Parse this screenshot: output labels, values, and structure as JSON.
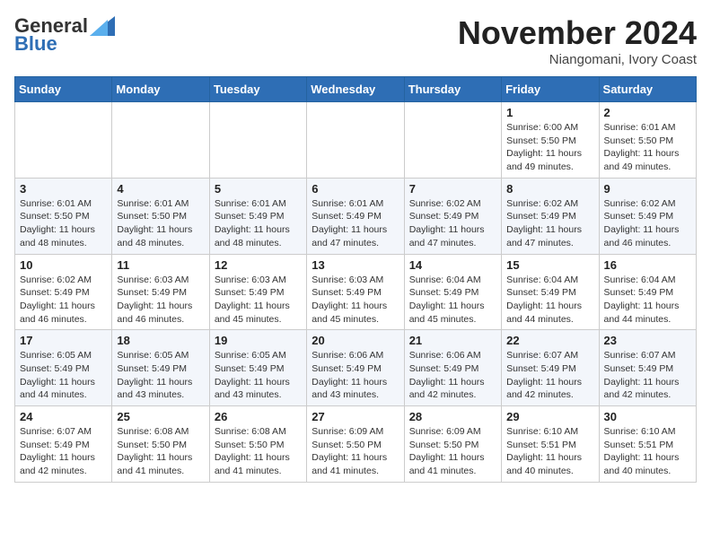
{
  "logo": {
    "general": "General",
    "blue": "Blue"
  },
  "header": {
    "month": "November 2024",
    "location": "Niangomani, Ivory Coast"
  },
  "weekdays": [
    "Sunday",
    "Monday",
    "Tuesday",
    "Wednesday",
    "Thursday",
    "Friday",
    "Saturday"
  ],
  "weeks": [
    [
      {
        "day": "",
        "info": ""
      },
      {
        "day": "",
        "info": ""
      },
      {
        "day": "",
        "info": ""
      },
      {
        "day": "",
        "info": ""
      },
      {
        "day": "",
        "info": ""
      },
      {
        "day": "1",
        "info": "Sunrise: 6:00 AM\nSunset: 5:50 PM\nDaylight: 11 hours and 49 minutes."
      },
      {
        "day": "2",
        "info": "Sunrise: 6:01 AM\nSunset: 5:50 PM\nDaylight: 11 hours and 49 minutes."
      }
    ],
    [
      {
        "day": "3",
        "info": "Sunrise: 6:01 AM\nSunset: 5:50 PM\nDaylight: 11 hours and 48 minutes."
      },
      {
        "day": "4",
        "info": "Sunrise: 6:01 AM\nSunset: 5:50 PM\nDaylight: 11 hours and 48 minutes."
      },
      {
        "day": "5",
        "info": "Sunrise: 6:01 AM\nSunset: 5:49 PM\nDaylight: 11 hours and 48 minutes."
      },
      {
        "day": "6",
        "info": "Sunrise: 6:01 AM\nSunset: 5:49 PM\nDaylight: 11 hours and 47 minutes."
      },
      {
        "day": "7",
        "info": "Sunrise: 6:02 AM\nSunset: 5:49 PM\nDaylight: 11 hours and 47 minutes."
      },
      {
        "day": "8",
        "info": "Sunrise: 6:02 AM\nSunset: 5:49 PM\nDaylight: 11 hours and 47 minutes."
      },
      {
        "day": "9",
        "info": "Sunrise: 6:02 AM\nSunset: 5:49 PM\nDaylight: 11 hours and 46 minutes."
      }
    ],
    [
      {
        "day": "10",
        "info": "Sunrise: 6:02 AM\nSunset: 5:49 PM\nDaylight: 11 hours and 46 minutes."
      },
      {
        "day": "11",
        "info": "Sunrise: 6:03 AM\nSunset: 5:49 PM\nDaylight: 11 hours and 46 minutes."
      },
      {
        "day": "12",
        "info": "Sunrise: 6:03 AM\nSunset: 5:49 PM\nDaylight: 11 hours and 45 minutes."
      },
      {
        "day": "13",
        "info": "Sunrise: 6:03 AM\nSunset: 5:49 PM\nDaylight: 11 hours and 45 minutes."
      },
      {
        "day": "14",
        "info": "Sunrise: 6:04 AM\nSunset: 5:49 PM\nDaylight: 11 hours and 45 minutes."
      },
      {
        "day": "15",
        "info": "Sunrise: 6:04 AM\nSunset: 5:49 PM\nDaylight: 11 hours and 44 minutes."
      },
      {
        "day": "16",
        "info": "Sunrise: 6:04 AM\nSunset: 5:49 PM\nDaylight: 11 hours and 44 minutes."
      }
    ],
    [
      {
        "day": "17",
        "info": "Sunrise: 6:05 AM\nSunset: 5:49 PM\nDaylight: 11 hours and 44 minutes."
      },
      {
        "day": "18",
        "info": "Sunrise: 6:05 AM\nSunset: 5:49 PM\nDaylight: 11 hours and 43 minutes."
      },
      {
        "day": "19",
        "info": "Sunrise: 6:05 AM\nSunset: 5:49 PM\nDaylight: 11 hours and 43 minutes."
      },
      {
        "day": "20",
        "info": "Sunrise: 6:06 AM\nSunset: 5:49 PM\nDaylight: 11 hours and 43 minutes."
      },
      {
        "day": "21",
        "info": "Sunrise: 6:06 AM\nSunset: 5:49 PM\nDaylight: 11 hours and 42 minutes."
      },
      {
        "day": "22",
        "info": "Sunrise: 6:07 AM\nSunset: 5:49 PM\nDaylight: 11 hours and 42 minutes."
      },
      {
        "day": "23",
        "info": "Sunrise: 6:07 AM\nSunset: 5:49 PM\nDaylight: 11 hours and 42 minutes."
      }
    ],
    [
      {
        "day": "24",
        "info": "Sunrise: 6:07 AM\nSunset: 5:49 PM\nDaylight: 11 hours and 42 minutes."
      },
      {
        "day": "25",
        "info": "Sunrise: 6:08 AM\nSunset: 5:50 PM\nDaylight: 11 hours and 41 minutes."
      },
      {
        "day": "26",
        "info": "Sunrise: 6:08 AM\nSunset: 5:50 PM\nDaylight: 11 hours and 41 minutes."
      },
      {
        "day": "27",
        "info": "Sunrise: 6:09 AM\nSunset: 5:50 PM\nDaylight: 11 hours and 41 minutes."
      },
      {
        "day": "28",
        "info": "Sunrise: 6:09 AM\nSunset: 5:50 PM\nDaylight: 11 hours and 41 minutes."
      },
      {
        "day": "29",
        "info": "Sunrise: 6:10 AM\nSunset: 5:51 PM\nDaylight: 11 hours and 40 minutes."
      },
      {
        "day": "30",
        "info": "Sunrise: 6:10 AM\nSunset: 5:51 PM\nDaylight: 11 hours and 40 minutes."
      }
    ]
  ]
}
